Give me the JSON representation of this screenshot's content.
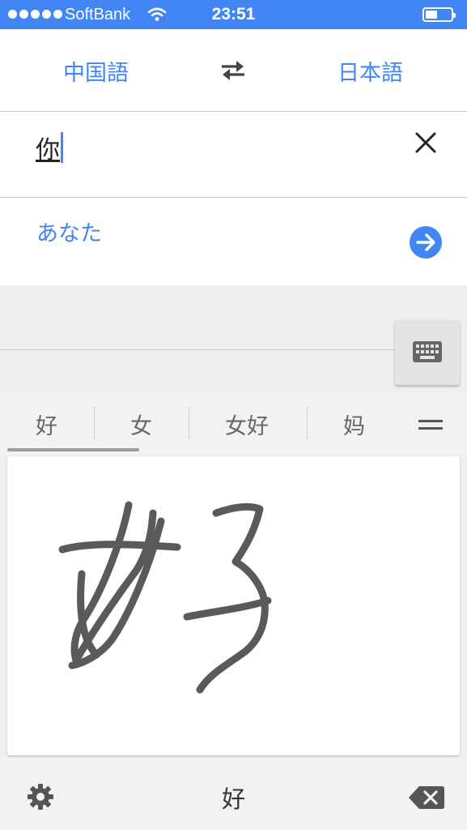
{
  "status_bar": {
    "carrier": "SoftBank",
    "time": "23:51"
  },
  "language_bar": {
    "source_language": "中国語",
    "target_language": "日本語"
  },
  "input": {
    "text": "你"
  },
  "result": {
    "text": "あなた"
  },
  "handwriting": {
    "candidates": [
      {
        "label": "好"
      },
      {
        "label": "女"
      },
      {
        "label": "女好"
      },
      {
        "label": "妈"
      }
    ],
    "preview_char": "好"
  },
  "icons": {
    "swap": "swap-arrows-icon",
    "clear": "close-icon",
    "go": "arrow-right-icon",
    "keyboard": "keyboard-icon",
    "menu": "menu-icon",
    "settings": "gear-icon",
    "backspace": "backspace-icon"
  },
  "colors": {
    "accent": "#4285f4",
    "ink": "#5a5a5a",
    "background": "#efefef"
  }
}
